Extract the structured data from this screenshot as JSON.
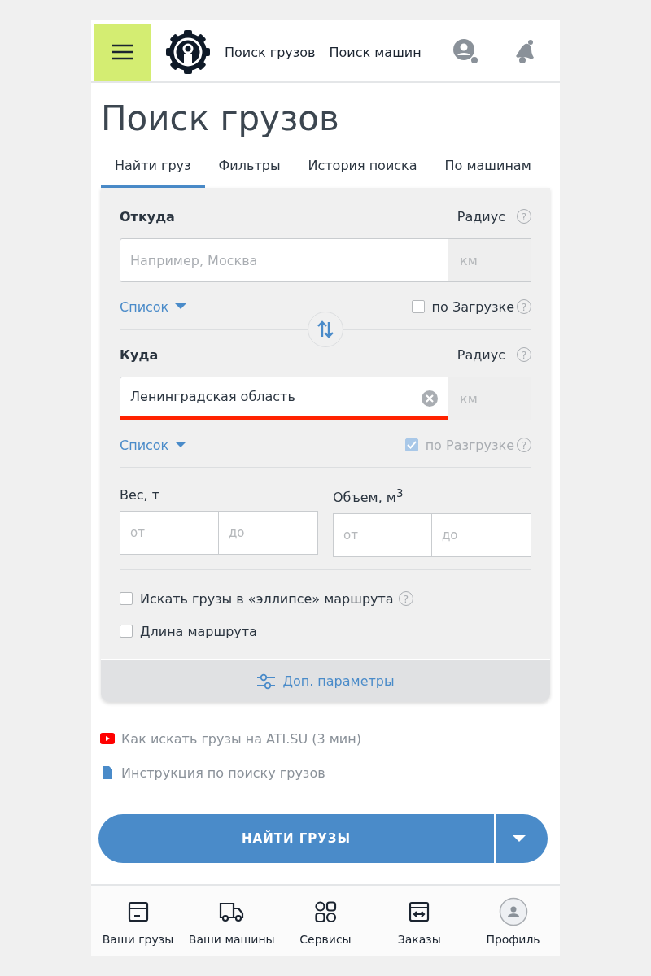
{
  "header": {
    "nav": [
      "Поиск грузов",
      "Поиск машин"
    ]
  },
  "title": "Поиск грузов",
  "tabs": [
    {
      "label": "Найти груз",
      "selected": true
    },
    {
      "label": "Фильтры",
      "selected": false
    },
    {
      "label": "История поиска",
      "selected": false
    },
    {
      "label": "По машинам",
      "selected": false
    }
  ],
  "form": {
    "from": {
      "label": "Откуда",
      "radius_label": "Радиус",
      "radius_help": "?",
      "placeholder": "Например, Москва",
      "invalid": false,
      "radius_placeholder": "км",
      "list_link": "Список",
      "checkbox": {
        "label": "по Загрузке",
        "checked": false,
        "disabled": false,
        "help": "?"
      }
    },
    "to": {
      "label": "Куда",
      "radius_label": "Радиус",
      "radius_help": "?",
      "value": "Ленинградская область",
      "invalid": true,
      "radius_placeholder": "км",
      "list_link": "Список",
      "checkbox": {
        "label": "по Разгрузке",
        "checked": true,
        "disabled": true,
        "help": "?"
      }
    },
    "ranges": [
      {
        "label": "Вес, т",
        "from_placeholder": "от",
        "to_placeholder": "до"
      },
      {
        "label": "Объем, м$^{3}$",
        "from_placeholder": "от",
        "to_placeholder": "до"
      }
    ],
    "options": [
      {
        "label": "Искать грузы в «эллипсе» маршрута",
        "checked": false,
        "help": "?"
      },
      {
        "label": "Длина маршрута",
        "checked": false
      }
    ],
    "more_params": "Доп. параметры"
  },
  "links": [
    {
      "kind": "video",
      "label": "Как искать грузы на ATI.SU (3 мин)"
    },
    {
      "kind": "document",
      "label": "Инструкция по поиску грузов"
    }
  ],
  "search_button": "НАЙТИ ГРУЗЫ",
  "bottom_nav": [
    {
      "label": "Ваши грузы"
    },
    {
      "label": "Ваши машины"
    },
    {
      "label": "Сервисы"
    },
    {
      "label": "Заказы"
    },
    {
      "label": "Профиль"
    }
  ]
}
